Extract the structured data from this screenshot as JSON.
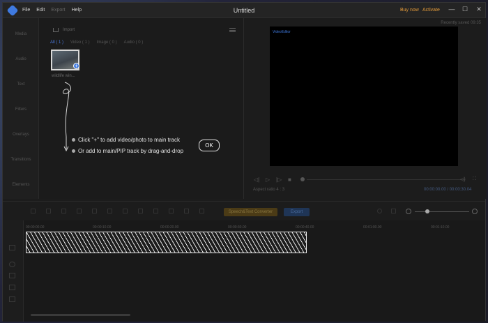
{
  "titlebar": {
    "menu": [
      "File",
      "Edit",
      "Export",
      "Help"
    ],
    "title": "Untitled",
    "buy_now": "Buy now",
    "activate": "Activate",
    "controls": {
      "minimize": "—",
      "maximize": "☐",
      "close": "✕"
    }
  },
  "sidebar": {
    "items": [
      "Media",
      "Audio",
      "Text",
      "Filters",
      "Overlays",
      "Transitions",
      "Elements"
    ]
  },
  "media": {
    "import_label": "Import",
    "filter_tabs": [
      "All ( 1 )",
      "Video ( 1 )",
      "Image ( 0 )",
      "Audio ( 0 )"
    ],
    "thumbnail_name": "wildlife win...",
    "tips": [
      "Click \"+\" to add video/photo to main track",
      "Or add to main/PIP track by drag-and-drop"
    ],
    "ok_label": "OK"
  },
  "preview": {
    "saved_status": "Recently saved 09:35",
    "watermark": "VideoEditor",
    "aspect_ratio_label": "Aspect ratio",
    "aspect_ratio_value": "4 : 3",
    "time_display": "00:00:00.00 / 00:00:30.04",
    "controls": [
      "◁|",
      "▷",
      "|▷",
      "■"
    ]
  },
  "toolbar": {
    "speech_to_text": "Speech&Text Converter",
    "export_label": "Export"
  },
  "timeline": {
    "ticks": [
      "00:00:00.00",
      "00:00:10.00",
      "00:00:20.00",
      "00:00:30.00",
      "00:00:40.00",
      "00:01:00.00",
      "00:01:10.00"
    ]
  },
  "colors": {
    "accent": "#3f7ae0",
    "orange": "#e39a3a",
    "background": "#1c1c1c"
  }
}
